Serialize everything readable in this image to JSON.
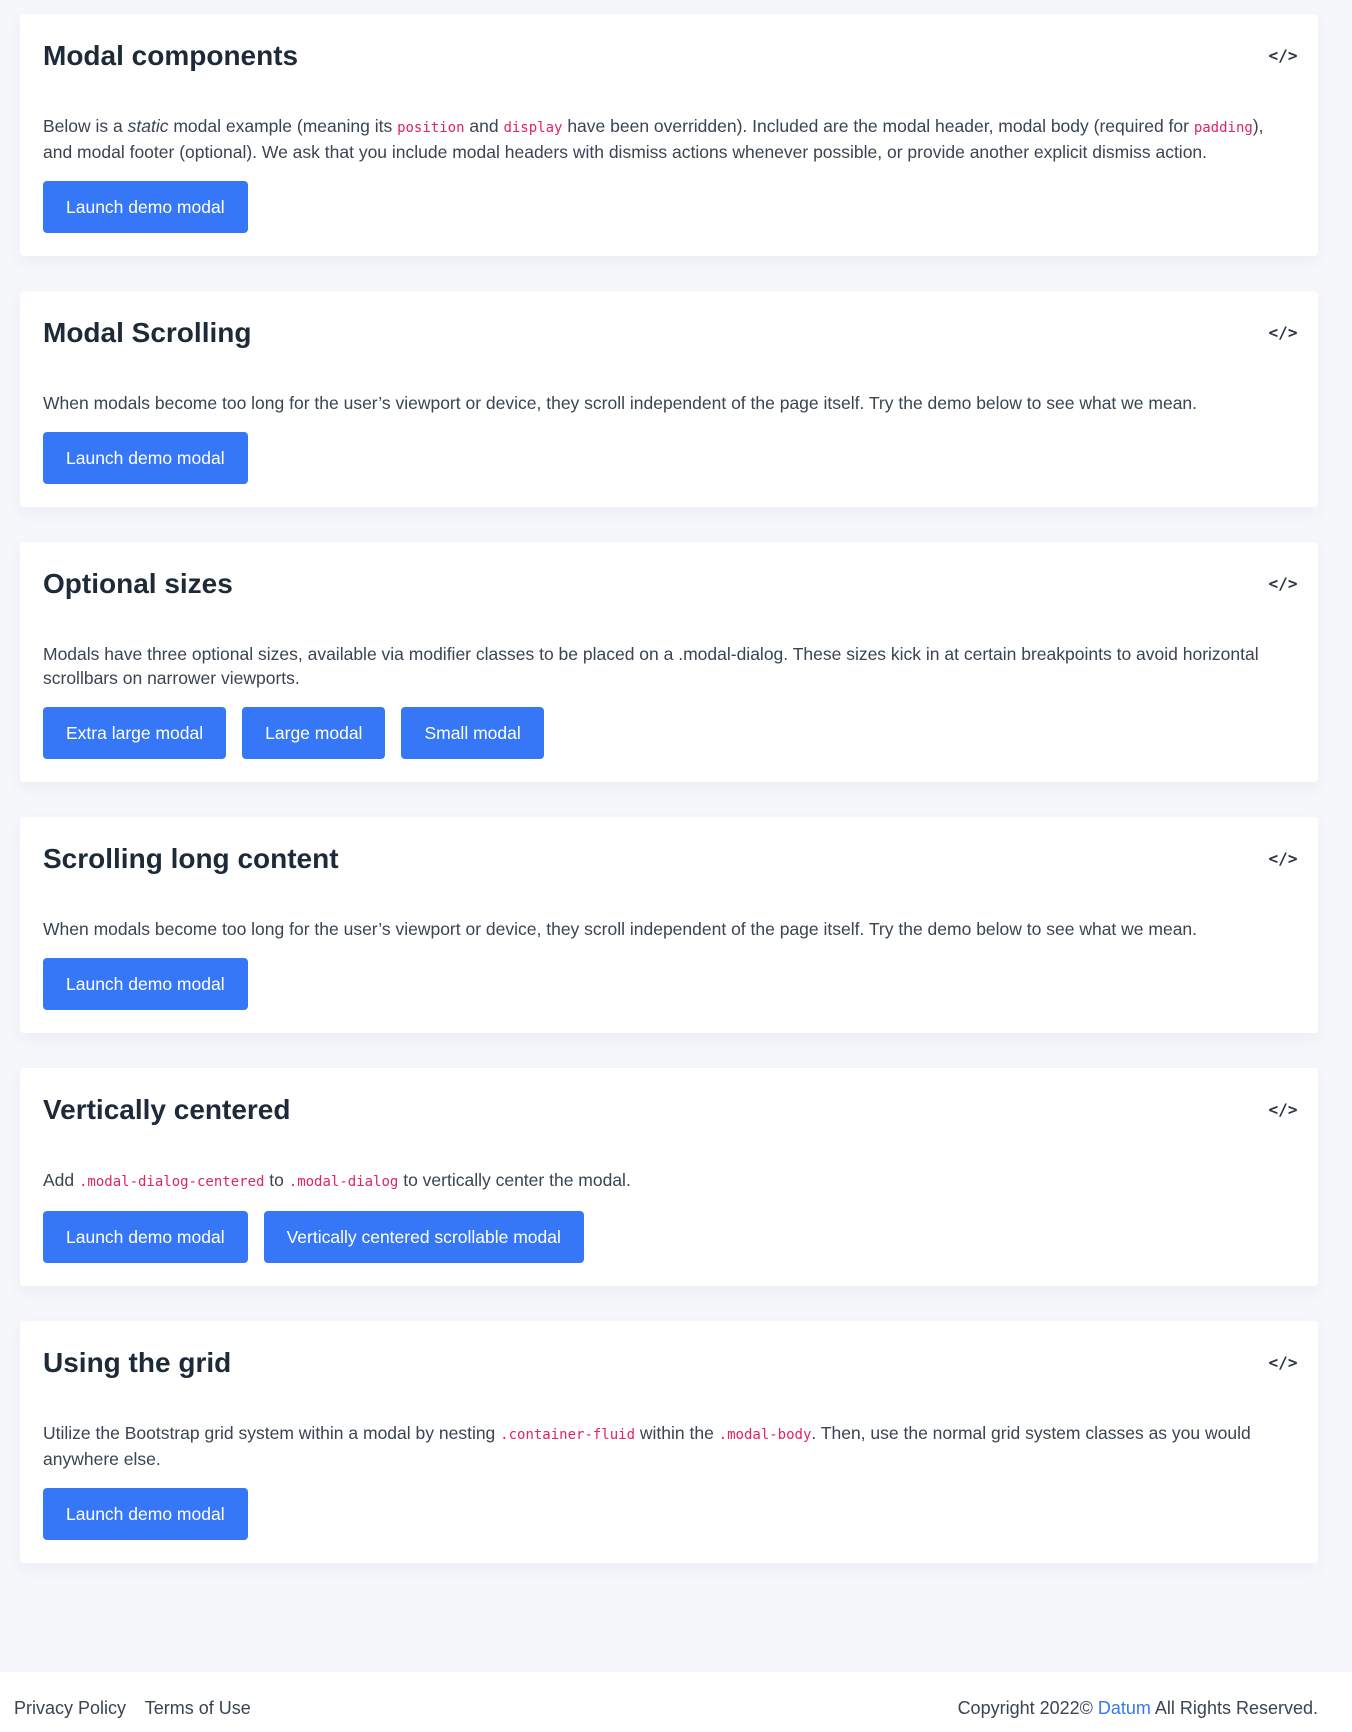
{
  "cards": [
    {
      "title": "Modal components",
      "icon": "code-icon",
      "text_parts": [
        "Below is a ",
        "static",
        " modal example (meaning its ",
        "position",
        " and ",
        "display",
        " have been overridden). Included are the modal header, modal body (required for ",
        "padding",
        "), and modal footer (optional). We ask that you include modal headers with dismiss actions whenever possible, or provide another explicit dismiss action."
      ],
      "buttons": [
        "Launch demo modal"
      ]
    },
    {
      "title": "Modal Scrolling",
      "icon": "code-icon",
      "text": "When modals become too long for the user’s viewport or device, they scroll independent of the page itself. Try the demo below to see what we mean.",
      "buttons": [
        "Launch demo modal"
      ]
    },
    {
      "title": "Optional sizes",
      "icon": "code-icon",
      "text": "Modals have three optional sizes, available via modifier classes to be placed on a .modal-dialog. These sizes kick in at certain breakpoints to avoid horizontal scrollbars on narrower viewports.",
      "buttons": [
        "Extra large modal",
        "Large modal",
        "Small modal"
      ]
    },
    {
      "title": "Scrolling long content",
      "icon": "code-icon",
      "text": "When modals become too long for the user’s viewport or device, they scroll independent of the page itself. Try the demo below to see what we mean.",
      "buttons": [
        "Launch demo modal"
      ]
    },
    {
      "title": "Vertically centered",
      "icon": "code-icon",
      "text_parts": [
        "Add ",
        ".modal-dialog-centered",
        " to ",
        ".modal-dialog",
        " to vertically center the modal."
      ],
      "buttons": [
        "Launch demo modal",
        "Vertically centered scrollable modal"
      ]
    },
    {
      "title": "Using the grid",
      "icon": "code-icon",
      "text_parts": [
        "Utilize the Bootstrap grid system within a modal by nesting ",
        ".container-fluid",
        " within the ",
        ".modal-body",
        ". Then, use the normal grid system classes as you would anywhere else."
      ],
      "buttons": [
        "Launch demo modal"
      ]
    }
  ],
  "footer": {
    "privacy": "Privacy Policy",
    "terms": "Terms of Use",
    "copyright_prefix": "Copyright 2022© ",
    "brand": "Datum",
    "copyright_suffix": " All Rights Reserved."
  },
  "colors": {
    "accent": "#3577f6",
    "code": "#e0245e",
    "heading": "#1e2a38"
  }
}
